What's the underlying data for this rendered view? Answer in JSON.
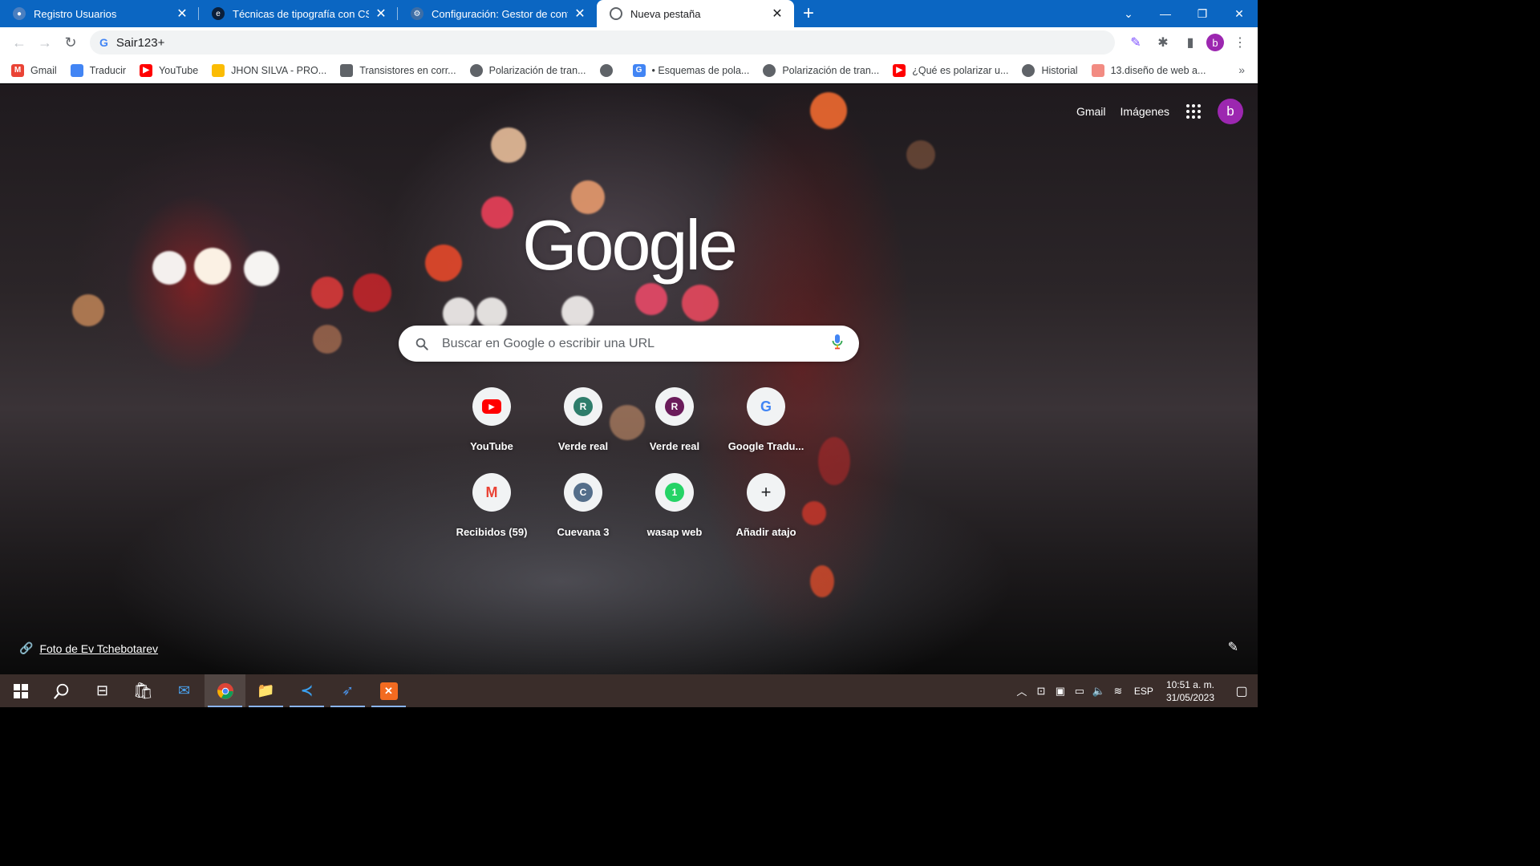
{
  "tabs": [
    {
      "title": "Registro Usuarios",
      "favicon_color": "#8ab4f8"
    },
    {
      "title": "Técnicas de tipografía con CSS",
      "favicon_color": "#0b1f3a"
    },
    {
      "title": "Configuración: Gestor de contras",
      "favicon_color": "#5f6368"
    },
    {
      "title": "Nueva pestaña",
      "favicon_color": "#ffffff"
    }
  ],
  "omnibox": {
    "value": "Sair123+"
  },
  "bookmarks": [
    {
      "label": "Gmail",
      "icon": "gmail-icon",
      "color": "#ea4335"
    },
    {
      "label": "Traducir",
      "icon": "translate-icon",
      "color": "#4285f4"
    },
    {
      "label": "YouTube",
      "icon": "youtube-icon",
      "color": "#ff0000"
    },
    {
      "label": "JHON SILVA - PRO...",
      "icon": "folder-icon",
      "color": "#fbbc04"
    },
    {
      "label": "Transistores en corr...",
      "icon": "transistor-icon",
      "color": "#5f6368"
    },
    {
      "label": "Polarización de tran...",
      "icon": "globe-icon",
      "color": "#5f6368"
    },
    {
      "label": "",
      "icon": "globe-icon",
      "color": "#5f6368"
    },
    {
      "label": "• Esquemas de pola...",
      "icon": "google-icon",
      "color": "#4285f4"
    },
    {
      "label": "Polarización de tran...",
      "icon": "globe-icon",
      "color": "#5f6368"
    },
    {
      "label": "¿Qué es polarizar u...",
      "icon": "youtube-icon",
      "color": "#ff0000"
    },
    {
      "label": "Historial",
      "icon": "history-icon",
      "color": "#5f6368"
    },
    {
      "label": "13.diseño de web a...",
      "icon": "bookmark-icon",
      "color": "#f28b82"
    }
  ],
  "top_links": {
    "gmail": "Gmail",
    "images": "Imágenes",
    "avatar_letter": "b"
  },
  "logo": "Google",
  "search": {
    "placeholder": "Buscar en Google o escribir una URL"
  },
  "shortcuts": [
    {
      "label": "YouTube",
      "letter": "▶",
      "color": "#ff0000",
      "icon": "youtube-icon"
    },
    {
      "label": "Verde real",
      "letter": "R",
      "color": "#2e7d6b",
      "icon": "letter-r-icon"
    },
    {
      "label": "Verde real",
      "letter": "R",
      "color": "#6a1b5a",
      "icon": "letter-r-icon"
    },
    {
      "label": "Google Tradu...",
      "letter": "G",
      "color": "#4285f4",
      "icon": "translate-icon"
    },
    {
      "label": "Recibidos (59)",
      "letter": "M",
      "color": "#ea4335",
      "icon": "gmail-icon"
    },
    {
      "label": "Cuevana 3",
      "letter": "C",
      "color": "#546e8a",
      "icon": "letter-c-icon"
    },
    {
      "label": "wasap web",
      "letter": "1",
      "color": "#25d366",
      "icon": "whatsapp-icon"
    },
    {
      "label": "Añadir atajo",
      "letter": "+",
      "color": "#202124",
      "icon": "plus-icon"
    }
  ],
  "credit": "Foto de Ev Tchebotarev",
  "taskbar": {
    "language": "ESP",
    "time": "10:51 a. m.",
    "date": "31/05/2023"
  }
}
